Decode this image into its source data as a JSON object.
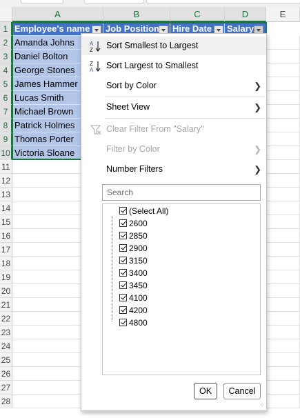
{
  "columns": [
    {
      "id": "corner",
      "label": ""
    },
    {
      "id": "A",
      "label": "A"
    },
    {
      "id": "B",
      "label": "B"
    },
    {
      "id": "C",
      "label": "C"
    },
    {
      "id": "D",
      "label": "D"
    },
    {
      "id": "E",
      "label": "E"
    }
  ],
  "row_numbers": [
    "1",
    "2",
    "3",
    "4",
    "5",
    "6",
    "7",
    "8",
    "9",
    "10",
    "11",
    "12",
    "13",
    "14",
    "15",
    "16",
    "17",
    "18",
    "19",
    "20",
    "21",
    "22",
    "23",
    "24",
    "25",
    "26",
    "27",
    "28"
  ],
  "table": {
    "headers": [
      "Employee's name",
      "Job Position",
      "Hire Date",
      "Salary"
    ],
    "names": [
      "Amanda Johns",
      "Daniel Bolton",
      "George Stones",
      "James Hammer",
      "Lucas Smith",
      "Michael Brown",
      "Patrick Holmes",
      "Thomas Porter",
      "Victoria Sloane"
    ]
  },
  "menu": {
    "sort_asc": "Sort Smallest to Largest",
    "sort_desc": "Sort Largest to Smallest",
    "sort_color": "Sort by Color",
    "sheet_view": "Sheet View",
    "clear_filter": "Clear Filter From \"Salary\"",
    "filter_color": "Filter by Color",
    "number_filters": "Number Filters",
    "search_placeholder": "Search",
    "values": [
      "(Select All)",
      "2600",
      "2850",
      "2900",
      "3150",
      "3400",
      "3450",
      "4100",
      "4200",
      "4800"
    ],
    "ok": "OK",
    "cancel": "Cancel",
    "icon_az_top": "A",
    "icon_az_bottom": "Z",
    "icon_za_top": "Z",
    "icon_za_bottom": "A"
  },
  "colors": {
    "accent": "#217346",
    "header_fill": "#4472c4",
    "name_fill": "#b4c6e7"
  }
}
